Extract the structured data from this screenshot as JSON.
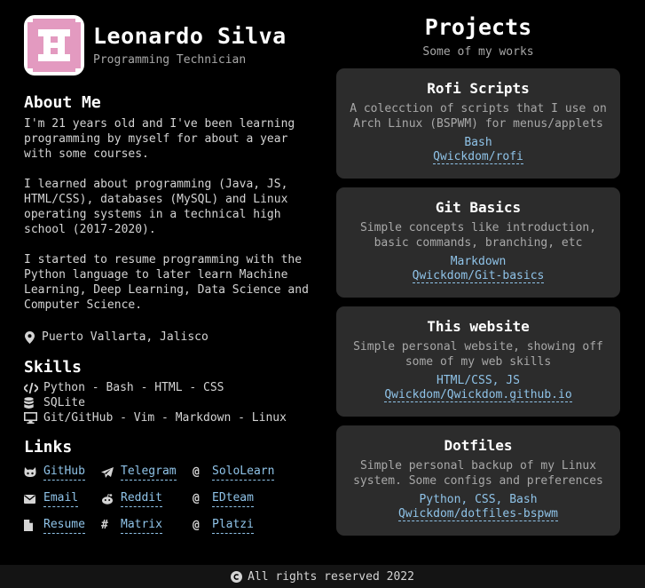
{
  "profile": {
    "name": "Leonardo Silva",
    "role": "Programming Technician"
  },
  "about": {
    "title": "About Me",
    "paragraphs": [
      "I'm 21 years old and I've been learning\nprogramming by myself for about a year\nwith some courses.",
      "I learned about programming (Java, JS,\nHTML/CSS), databases (MySQL) and Linux\noperating systems in a technical high\nschool (2017-2020).",
      "I started to resume programming with the\nPython language to later learn Machine\nLearning, Deep Learning, Data Science and\nComputer Science."
    ],
    "location": "Puerto Vallarta, Jalisco"
  },
  "skills": {
    "title": "Skills",
    "items": [
      {
        "icon": "code-icon",
        "text": "Python - Bash - HTML - CSS"
      },
      {
        "icon": "database-icon",
        "text": "SQLite"
      },
      {
        "icon": "monitor-icon",
        "text": "Git/GitHub - Vim - Markdown - Linux"
      }
    ]
  },
  "links": {
    "title": "Links",
    "items": [
      {
        "icon": "github-icon",
        "label": "GitHub"
      },
      {
        "icon": "telegram-icon",
        "label": "Telegram"
      },
      {
        "icon": "at-icon",
        "label": "SoloLearn"
      },
      {
        "icon": "email-icon",
        "label": "Email"
      },
      {
        "icon": "reddit-icon",
        "label": "Reddit"
      },
      {
        "icon": "at-icon",
        "label": "EDteam"
      },
      {
        "icon": "file-icon",
        "label": "Resume"
      },
      {
        "icon": "hash-icon",
        "label": "Matrix"
      },
      {
        "icon": "at-icon",
        "label": "Platzi"
      }
    ]
  },
  "projects": {
    "title": "Projects",
    "subtitle": "Some of my works",
    "cards": [
      {
        "title": "Rofi Scripts",
        "desc": "A colecction of scripts that I use on\nArch Linux (BSPWM) for menus/applets",
        "tech": "Bash",
        "link": "Qwickdom/rofi"
      },
      {
        "title": "Git Basics",
        "desc": "Simple concepts like introduction,\nbasic commands, branching, etc",
        "tech": "Markdown",
        "link": "Qwickdom/Git-basics"
      },
      {
        "title": "This website",
        "desc": "Simple personal website, showing off\nsome of my web skills",
        "tech": "HTML/CSS, JS",
        "link": "Qwickdom/Qwickdom.github.io"
      },
      {
        "title": "Dotfiles",
        "desc": "Simple personal backup of my Linux\nsystem. Some configs and preferences",
        "tech": "Python, CSS, Bash",
        "link": "Qwickdom/dotfiles-bspwm"
      }
    ]
  },
  "footer": {
    "text": "All rights reserved 2022"
  },
  "colors": {
    "background": "#000000",
    "card": "#2c2c2c",
    "link": "#8fc3e8",
    "muted": "#a8a8a8",
    "avatar_accent": "#e39ac0"
  }
}
